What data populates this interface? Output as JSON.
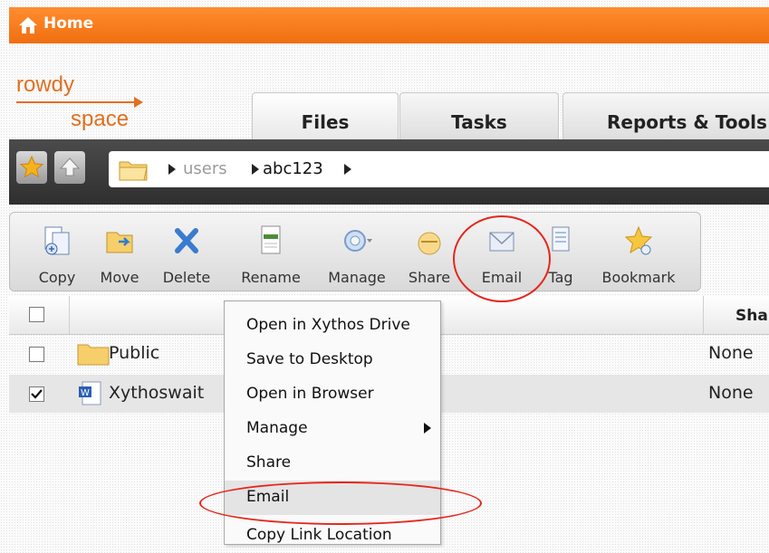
{
  "topbar": {
    "title": "Home"
  },
  "logo": {
    "line1": "rowdy",
    "line2": "space"
  },
  "tabs": [
    {
      "label": "Files"
    },
    {
      "label": "Tasks"
    },
    {
      "label": "Reports & Tools"
    }
  ],
  "breadcrumb": {
    "items": [
      "users",
      "abc123"
    ]
  },
  "toolbar": {
    "buttons": [
      {
        "label": "Copy",
        "icon": "copy-icon"
      },
      {
        "label": "Move",
        "icon": "move-icon"
      },
      {
        "label": "Delete",
        "icon": "delete-icon"
      },
      {
        "label": "Rename",
        "icon": "rename-icon"
      },
      {
        "label": "Manage",
        "icon": "gear-icon"
      },
      {
        "label": "Share",
        "icon": "share-icon"
      },
      {
        "label": "Email",
        "icon": "email-icon"
      },
      {
        "label": "Tag",
        "icon": "tag-icon"
      },
      {
        "label": "Bookmark",
        "icon": "star-icon"
      }
    ]
  },
  "table": {
    "share_header": "Sha",
    "rows": [
      {
        "name": "Public",
        "sharing": "None",
        "checked": false
      },
      {
        "name": "Xythoswait",
        "sharing": "None",
        "checked": true
      }
    ]
  },
  "context_menu": {
    "items": [
      {
        "label": "Open in Xythos Drive"
      },
      {
        "label": "Save to Desktop"
      },
      {
        "label": "Open in Browser"
      },
      {
        "label": "Manage",
        "submenu": true
      },
      {
        "label": "Share"
      },
      {
        "label": "Email"
      },
      {
        "label": "Copy Link Location"
      }
    ]
  },
  "colors": {
    "topbar": "#f47b20",
    "accent": "#e07020",
    "annotation": "#e6261c"
  }
}
